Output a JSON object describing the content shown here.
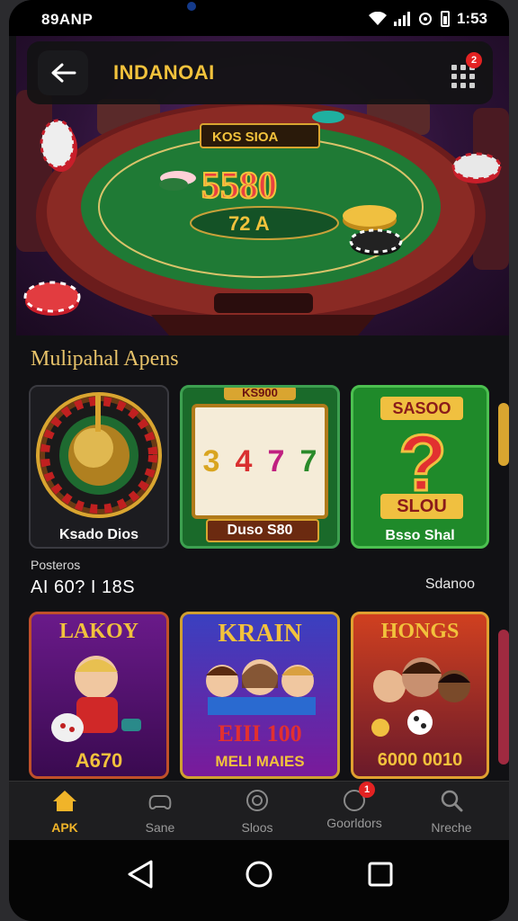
{
  "status": {
    "carrier": "89ANP",
    "time": "1:53"
  },
  "header": {
    "title": "INDANOAI",
    "notification_badge": "2"
  },
  "hero": {
    "plaque_text": "KOS SIOA",
    "jackpot_text": "5580",
    "pot_text": "72 A"
  },
  "section": {
    "title": "Mulipahal Apens"
  },
  "featured": [
    {
      "label": "Ksado Dios",
      "kind": "roulette"
    },
    {
      "label": "Duso S80",
      "kind": "slots",
      "banner": "KS900",
      "reels": [
        "3",
        "4",
        "7",
        "7"
      ]
    },
    {
      "label": "Bsso Shal",
      "kind": "mystery",
      "top": "SASOO",
      "bottom": "SLOU"
    }
  ],
  "subheader": {
    "caption": "Posteros",
    "count": "AI 60? I 18S",
    "link": "Sdanoo"
  },
  "games": [
    {
      "title": "LAKOY",
      "bottom": "A670"
    },
    {
      "title": "KRAIN",
      "mid": "EIII 100",
      "bottom": "MELI MAIES"
    },
    {
      "title": "HONGS",
      "bottom": "6000 0010"
    }
  ],
  "nav": [
    {
      "label": "APK",
      "icon": "home-icon",
      "active": true
    },
    {
      "label": "Sane",
      "icon": "controller-icon"
    },
    {
      "label": "Sloos",
      "icon": "coin-icon"
    },
    {
      "label": "Goorldors",
      "icon": "chat-icon",
      "badge": "1"
    },
    {
      "label": "Nreche",
      "icon": "search-icon"
    }
  ],
  "colors": {
    "accent": "#f0b429",
    "felt": "#1f7a35",
    "rail": "#7a2020"
  }
}
